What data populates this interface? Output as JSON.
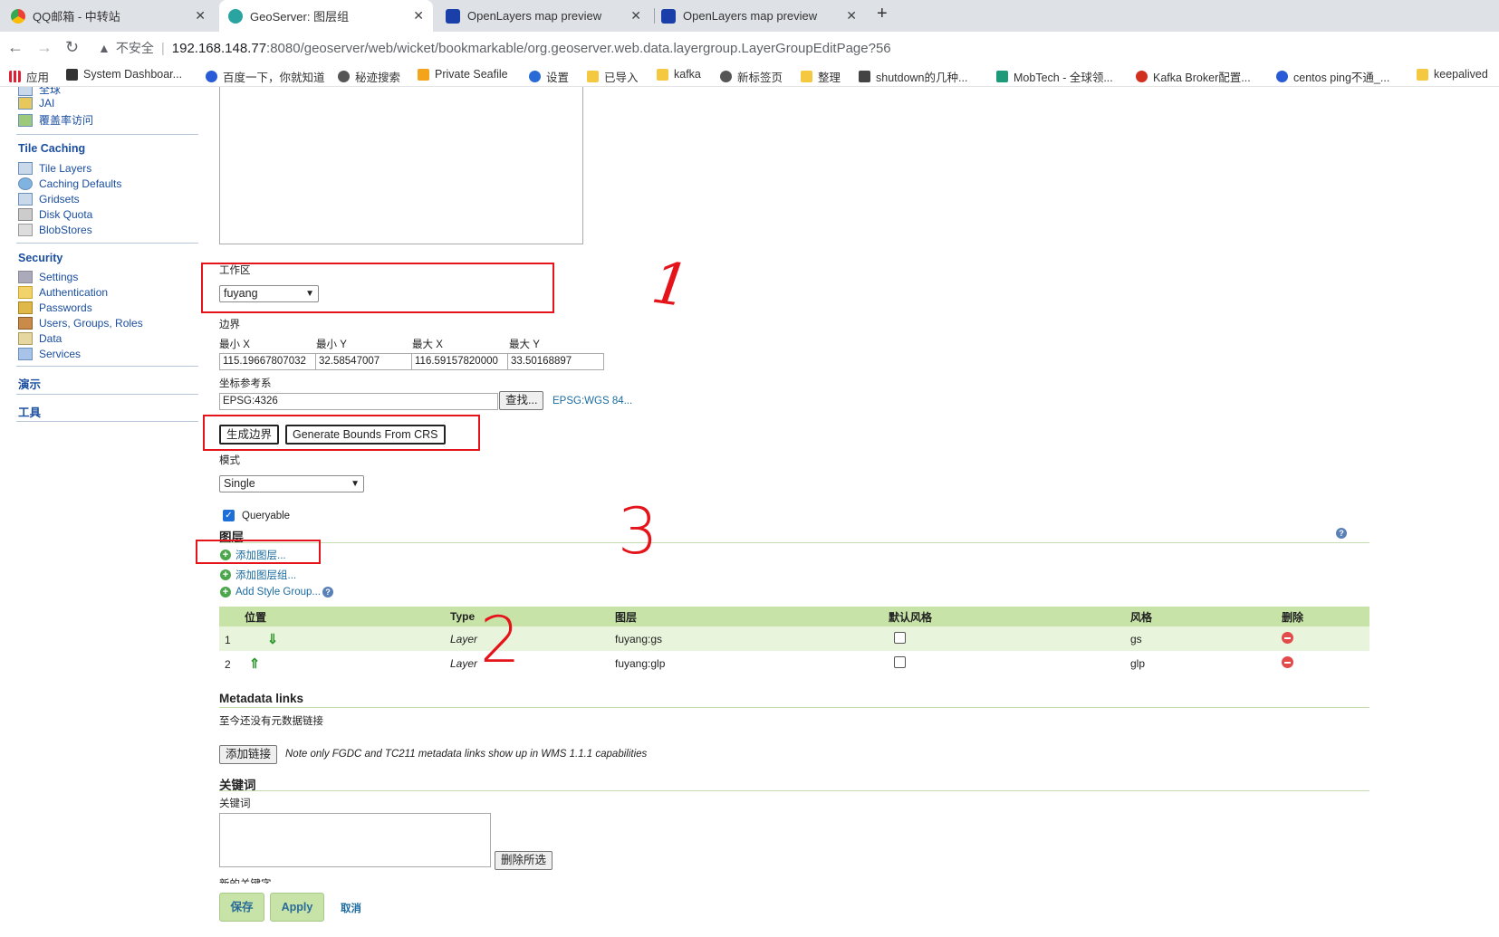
{
  "browser": {
    "tabs": [
      {
        "title": "QQ邮箱 - 中转站",
        "icon": "qq-mail-icon"
      },
      {
        "title": "GeoServer: 图层组",
        "icon": "geoserver-icon",
        "active": true
      },
      {
        "title": "OpenLayers map preview",
        "icon": "openlayers-icon"
      },
      {
        "title": "OpenLayers map preview",
        "icon": "openlayers-icon"
      }
    ],
    "insecure_label": "不安全",
    "url_host": "192.168.148.77",
    "url_path": ":8080/geoserver/web/wicket/bookmarkable/org.geoserver.web.data.layergroup.LayerGroupEditPage?56",
    "bookmarks": [
      "应用",
      "System Dashboar...",
      "百度一下，你就知道",
      "秘迹搜索",
      "Private Seafile",
      "设置",
      "已导入",
      "kafka",
      "新标签页",
      "整理",
      "shutdown的几种...",
      "MobTech - 全球领...",
      "Kafka Broker配置...",
      "centos ping不通_...",
      "keepalived"
    ]
  },
  "sidebar": {
    "top_items": [
      "全球",
      "JAI",
      "覆盖率访问"
    ],
    "tile_caching": {
      "heading": "Tile Caching",
      "items": [
        "Tile Layers",
        "Caching Defaults",
        "Gridsets",
        "Disk Quota",
        "BlobStores"
      ]
    },
    "security": {
      "heading": "Security",
      "items": [
        "Settings",
        "Authentication",
        "Passwords",
        "Users, Groups, Roles",
        "Data",
        "Services"
      ]
    },
    "demo_heading": "演示",
    "tools_heading": "工具"
  },
  "form": {
    "workspace_label": "工作区",
    "workspace_value": "fuyang",
    "bounds_label": "边界",
    "minx_label": "最小 X",
    "miny_label": "最小 Y",
    "maxx_label": "最大 X",
    "maxy_label": "最大 Y",
    "minx_value": "115.19667807032",
    "miny_value": "32.58547007",
    "maxx_value": "116.59157820000",
    "maxy_value": "33.50168897",
    "crs_label": "坐标参考系",
    "crs_value": "EPSG:4326",
    "find_button": "查找...",
    "crs_link": "EPSG:WGS 84...",
    "generate_bounds_button": "生成边界",
    "generate_from_crs_button": "Generate Bounds From CRS",
    "mode_label": "模式",
    "mode_value": "Single",
    "queryable_label": "Queryable"
  },
  "layers_section": {
    "title": "图层",
    "add_layer": "添加图层...",
    "add_layer_group": "添加图层组...",
    "add_style_group": "Add Style Group...",
    "columns": [
      "位置",
      "Type",
      "图层",
      "默认风格",
      "风格",
      "删除"
    ],
    "rows": [
      {
        "position": "1",
        "arrow": "⇓",
        "type": "Layer",
        "layer": "fuyang:gs",
        "style": "gs"
      },
      {
        "position": "2",
        "arrow": "⇑",
        "type": "Layer",
        "layer": "fuyang:glp",
        "style": "glp"
      }
    ]
  },
  "metadata": {
    "title": "Metadata links",
    "empty_text": "至今还没有元数据链接",
    "add_button": "添加链接",
    "note": "Note only FGDC and TC211 metadata links show up in WMS 1.1.1 capabilities"
  },
  "keywords": {
    "title": "关键词",
    "label": "关键词",
    "remove_button": "删除所选",
    "new_keyword_label": "新的关键字"
  },
  "actions": {
    "save": "保存",
    "apply": "Apply",
    "cancel": "取消"
  },
  "annotations": {
    "mark_1": "1",
    "mark_2": "2",
    "mark_3": "3",
    "color": "#e4141a"
  }
}
